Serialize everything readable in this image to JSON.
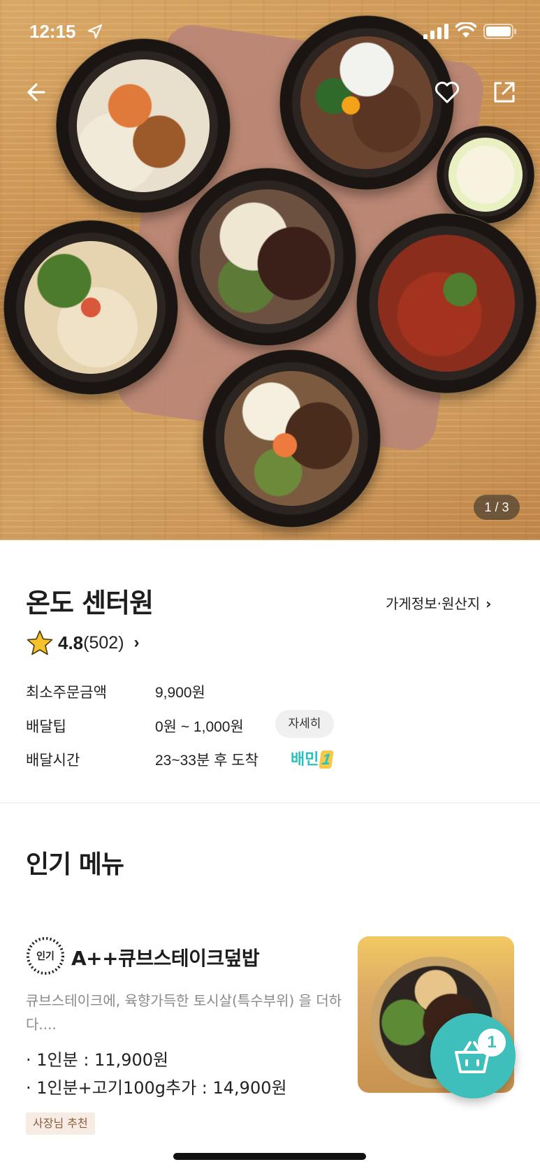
{
  "status_bar": {
    "time": "12:15"
  },
  "hero": {
    "image_counter": "1 / 3"
  },
  "store": {
    "name": "온도 센터원",
    "info_link": "가게정보·원산지",
    "rating": "4.8",
    "review_count": "(502)",
    "min_order_label": "최소주문금액",
    "min_order_value": "9,900원",
    "delivery_tip_label": "배달팁",
    "delivery_tip_value": "0원 ~ 1,000원",
    "detail_button": "자세히",
    "delivery_time_label": "배달시간",
    "delivery_time_value": "23~33분 후 도착",
    "baemin_badge": "배민",
    "baemin_badge_num": "1"
  },
  "popular_section": {
    "title": "인기 메뉴",
    "items": [
      {
        "badge": "인기",
        "name": "A++큐브스테이크덮밥",
        "description": "큐브스테이크에, 육향가득한 토시살(특수부위) 을 더하다....",
        "prices": [
          "· 1인분 : 11,900원",
          "· 1인분+고기100g추가 : 14,900원"
        ],
        "tag": "사장님 추천"
      }
    ]
  },
  "cart": {
    "count": "1"
  },
  "colors": {
    "accent": "#3fbfbb",
    "baemin": "#2ac1bc"
  }
}
